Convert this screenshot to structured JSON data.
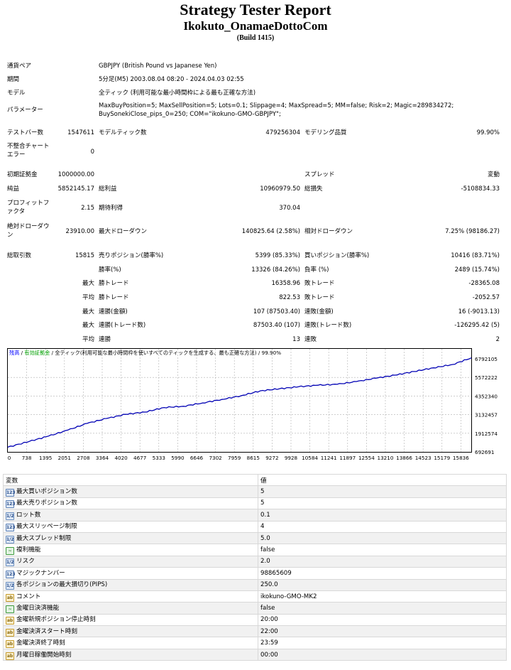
{
  "header": {
    "title": "Strategy Tester Report",
    "ea_name": "Ikokuto_OnamaeDottoCom",
    "build": "(Build 1415)"
  },
  "info": {
    "symbol_label": "通貨ペア",
    "symbol_value": "GBPJPY (British Pound vs Japanese Yen)",
    "period_label": "期間",
    "period_value": "5分足(M5) 2003.08.04 08:20 - 2024.04.03 02:55",
    "model_label": "モデル",
    "model_value": "全ティック (利用可能な最小時間枠による最も正確な方法)",
    "params_label": "パラメーター",
    "params_line1": "MaxBuyPosition=5; MaxSellPosition=5; Lots=0.1; Slippage=4; MaxSpread=5; MM=false; Risk=2; Magic=289834272;",
    "params_line2": "BuySonekiClose_pips_0=250; COM=\"ikokuno-GMO-GBPJPY\";"
  },
  "stats": {
    "bars_label": "テストバー数",
    "bars_value": "1547611",
    "ticks_label": "モデルティック数",
    "ticks_value": "479256304",
    "quality_label": "モデリング品質",
    "quality_value": "99.90%",
    "mismatch_label1": "不整合チャート",
    "mismatch_label2": "エラー",
    "mismatch_value": "0",
    "deposit_label": "初期証拠金",
    "deposit_value": "1000000.00",
    "spread_label": "スプレッド",
    "spread_value": "変動",
    "netprofit_label": "純益",
    "netprofit_value": "5852145.17",
    "grossprofit_label": "総利益",
    "grossprofit_value": "10960979.50",
    "grossloss_label": "総損失",
    "grossloss_value": "-5108834.33",
    "pf_label1": "プロフィットフ",
    "pf_label2": "ァクタ",
    "pf_value": "2.15",
    "expected_label": "期待利得",
    "expected_value": "370.04",
    "absdd_label1": "絶対ドローダウ",
    "absdd_label2": "ン",
    "absdd_value": "23910.00",
    "maxdd_label": "最大ドローダウン",
    "maxdd_value": "140825.64 (2.58%)",
    "reldd_label": "相対ドローダウン",
    "reldd_value": "7.25% (98186.27)",
    "trades_label": "総取引数",
    "trades_value": "15815",
    "short_label": "売りポジション(勝率%)",
    "short_value": "5399 (85.33%)",
    "long_label": "買いポジション(勝率%)",
    "long_value": "10416 (83.71%)",
    "winrate_label": "勝率(%)",
    "winrate_value": "13326 (84.26%)",
    "lossrate_label": "負率 (%)",
    "lossrate_value": "2489 (15.74%)",
    "max_label": "最大",
    "avg_label": "平均",
    "maxwin_label": "勝トレード",
    "maxwin_value": "16358.96",
    "maxloss_label": "敗トレード",
    "maxloss_value": "-28365.08",
    "avgwin_label": "勝トレード",
    "avgwin_value": "822.53",
    "avgloss_label": "敗トレード",
    "avgloss_value": "-2052.57",
    "conswin_label": "連勝(金額)",
    "conswin_value": "107 (87503.40)",
    "consloss_label": "連敗(金額)",
    "consloss_value": "16 (-9013.13)",
    "consprofit_label": "連勝(トレード数)",
    "consprofit_value": "87503.40 (107)",
    "consloss2_label": "連敗(トレード数)",
    "consloss2_value": "-126295.42 (5)",
    "avgcons_win_label": "連勝",
    "avgcons_win_value": "13",
    "avgcons_loss_label": "連敗",
    "avgcons_loss_value": "2"
  },
  "chart_data": {
    "type": "line",
    "legend": {
      "balance": "残高",
      "separator1": " / ",
      "equity": "有効証拠金",
      "separator2": " / ",
      "model": "全ティック(利用可能な最小時間枠を使いすべてのティックを生成する、最も正確な方法)",
      "separator3": " / ",
      "quality": "99.90%"
    },
    "x_ticks": [
      "0",
      "738",
      "1395",
      "2051",
      "2708",
      "3364",
      "4020",
      "4677",
      "5333",
      "5990",
      "6646",
      "7302",
      "7959",
      "8615",
      "9272",
      "9928",
      "10584",
      "11241",
      "11897",
      "12554",
      "13210",
      "13866",
      "14523",
      "15179",
      "15836"
    ],
    "y_ticks": [
      "6792105",
      "5572222",
      "4352340",
      "3132457",
      "1912574",
      "692691"
    ],
    "xlim": [
      0,
      15815
    ],
    "ylim": [
      692691,
      6792105
    ],
    "series": [
      {
        "color": "#0000b4",
        "x": [
          0,
          738,
          1395,
          2051,
          2708,
          3364,
          4020,
          4677,
          5333,
          5990,
          6646,
          7302,
          7959,
          8615,
          9272,
          9928,
          10584,
          11241,
          11897,
          12554,
          13210,
          13866,
          14523,
          15179,
          15815
        ],
        "y": [
          1000000,
          1380000,
          1730000,
          2120000,
          2560000,
          2880000,
          3150000,
          3300000,
          3600000,
          3680000,
          3900000,
          4130000,
          4370000,
          4690000,
          4830000,
          4960000,
          5060000,
          5120000,
          5300000,
          5520000,
          5720000,
          5960000,
          6200000,
          6420000,
          6852000
        ]
      }
    ],
    "colors": {
      "line": "#0000b4",
      "grid": "#b0b0b0",
      "balance_label": "#0000ff",
      "equity_label": "#00a000"
    }
  },
  "params_table": {
    "col_name": "変数",
    "col_value": "値",
    "rows": [
      {
        "icon": "123",
        "type": "int",
        "name": "最大買いポジション数",
        "value": "5"
      },
      {
        "icon": "123",
        "type": "int",
        "name": "最大売りポジション数",
        "value": "5"
      },
      {
        "icon": "1/2",
        "type": "flt",
        "name": "ロット数",
        "value": "0.1"
      },
      {
        "icon": "123",
        "type": "int",
        "name": "最大スリッページ制限",
        "value": "4"
      },
      {
        "icon": "1/2",
        "type": "flt",
        "name": "最大スプレッド制限",
        "value": "5.0"
      },
      {
        "icon": "~",
        "type": "bool",
        "name": "複利機能",
        "value": "false"
      },
      {
        "icon": "1/2",
        "type": "flt",
        "name": "リスク",
        "value": "2.0"
      },
      {
        "icon": "123",
        "type": "int",
        "name": "マジックナンバー",
        "value": "98865609"
      },
      {
        "icon": "1/2",
        "type": "flt",
        "name": "各ポジションの最大損切り(PIPS)",
        "value": "250.0"
      },
      {
        "icon": "ab",
        "type": "str",
        "name": "コメント",
        "value": "ikokuno-GMO-MK2"
      },
      {
        "icon": "~",
        "type": "bool",
        "name": "金曜日決済機能",
        "value": "false"
      },
      {
        "icon": "ab",
        "type": "str",
        "name": "金曜新規ポジション停止時刻",
        "value": "20:00"
      },
      {
        "icon": "ab",
        "type": "str",
        "name": "金曜決済スタート時刻",
        "value": "22:00"
      },
      {
        "icon": "ab",
        "type": "str",
        "name": "金曜決済終了時刻",
        "value": "23:59"
      },
      {
        "icon": "ab",
        "type": "str",
        "name": "月曜日稼働開始時刻",
        "value": "00:00"
      }
    ]
  }
}
